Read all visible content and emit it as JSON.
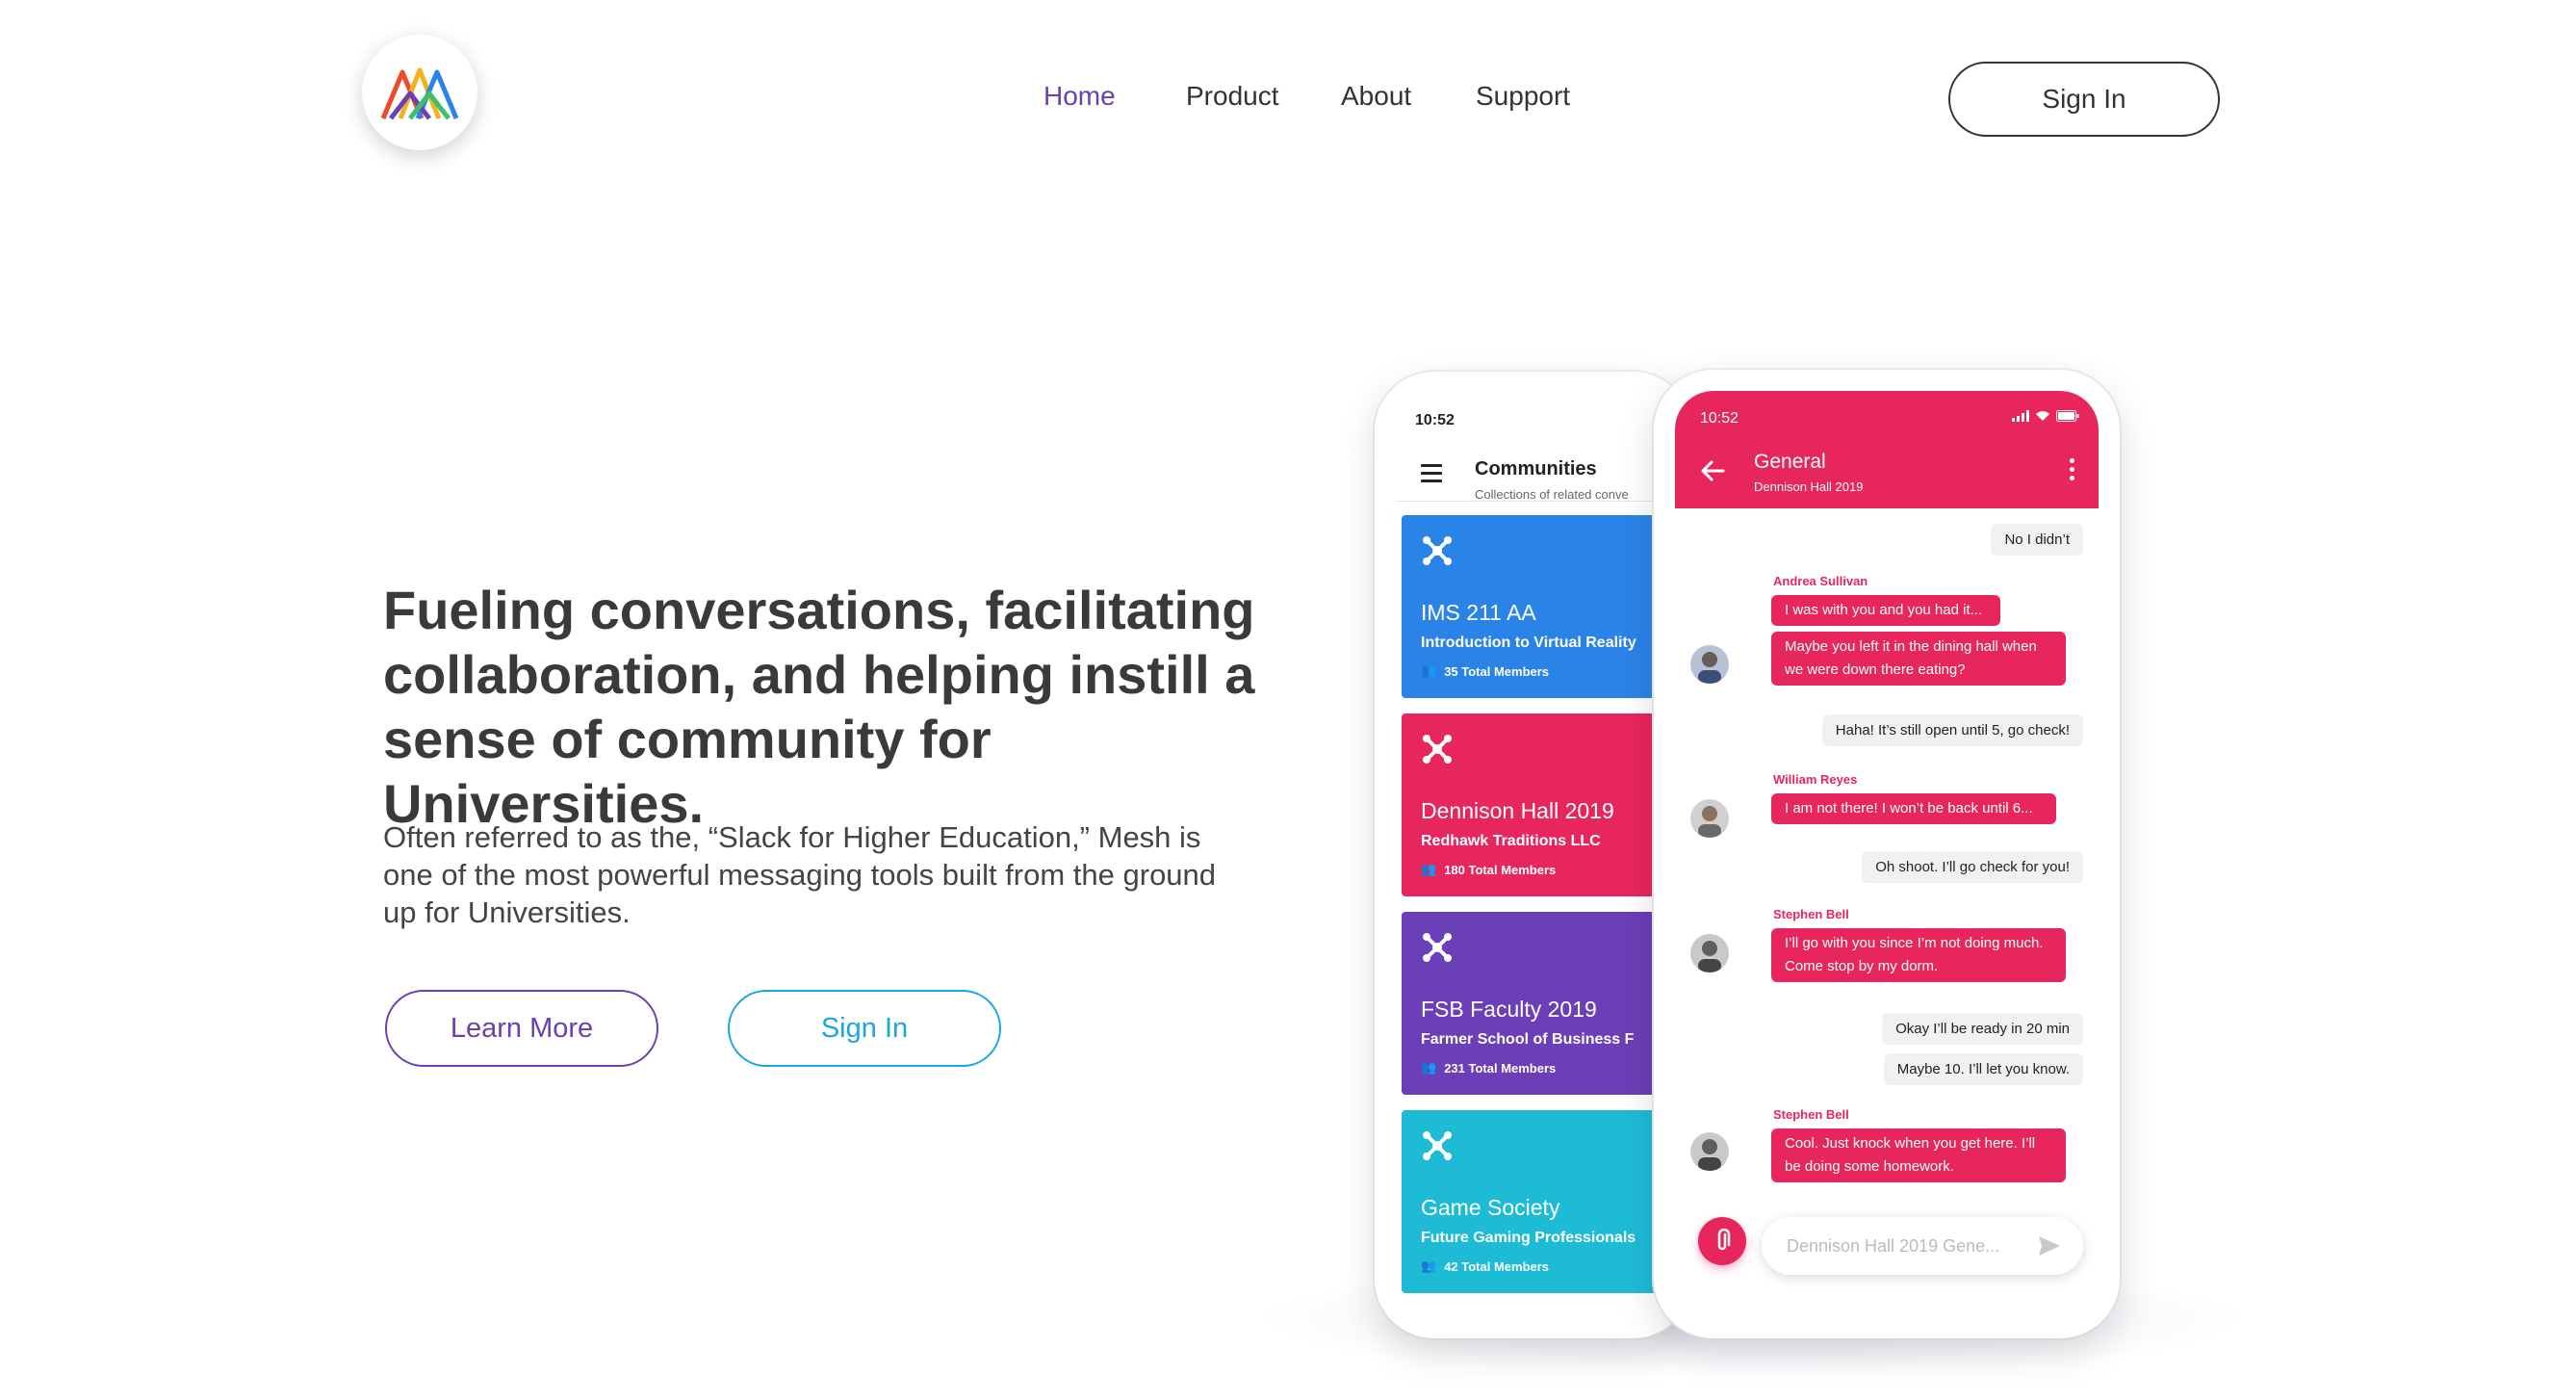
{
  "nav": {
    "items": [
      {
        "label": "Home",
        "active": true
      },
      {
        "label": "Product",
        "active": false
      },
      {
        "label": "About",
        "active": false
      },
      {
        "label": "Support",
        "active": false
      }
    ],
    "sign_in": "Sign In"
  },
  "hero": {
    "title": "Fueling conversations, facilitating collaboration, and helping instill a sense of community for Universities.",
    "subtitle": "Often referred to as the, “Slack for Higher Education,” Mesh is one of the most powerful messaging tools built from the ground up for Universities.",
    "learn_more": "Learn More",
    "sign_in": "Sign In"
  },
  "colors": {
    "accent_purple": "#6a3fb0",
    "accent_blue": "#1aa6e0",
    "chat_pink": "#e8265e"
  },
  "communities_phone": {
    "time": "10:52",
    "title": "Communities",
    "subtitle": "Collections of related conve",
    "cards": [
      {
        "name": "IMS 211 AA",
        "desc": "Introduction to Virtual Reality",
        "members": "35 Total Members",
        "color": "#2a84e8"
      },
      {
        "name": "Dennison Hall 2019",
        "desc": "Redhawk Traditions LLC",
        "members": "180 Total Members",
        "color": "#e8265e"
      },
      {
        "name": "FSB Faculty 2019",
        "desc": "Farmer School of Business F",
        "members": "231 Total Members",
        "color": "#6a3fb7"
      },
      {
        "name": "Game Society",
        "desc": "Future Gaming Professionals",
        "members": "42 Total Members",
        "color": "#1ebbd7"
      }
    ]
  },
  "chat_phone": {
    "time": "10:52",
    "title": "General",
    "subtitle": "Dennison Hall 2019",
    "messages": {
      "m1": "No I didn’t",
      "andrea": "Andrea Sullivan",
      "m2": "I was with you and you had it...",
      "m3": "Maybe you left it in the dining hall when we were down there eating?",
      "m4": "Haha! It’s still open until 5, go check!",
      "william": "William Reyes",
      "m5": "I am not there! I won’t be back until 6...",
      "m6": "Oh shoot. I’ll go check for you!",
      "stephen1": "Stephen Bell",
      "m7": "I’ll go with you since I’m not doing much. Come stop by my dorm.",
      "m8": "Okay I’ll be ready in 20 min",
      "m9": "Maybe 10. I’ll let you know.",
      "stephen2": "Stephen Bell",
      "m10": "Cool. Just knock when you get here. I’ll be doing some homework."
    },
    "input_placeholder": "Dennison Hall 2019 Gene..."
  }
}
